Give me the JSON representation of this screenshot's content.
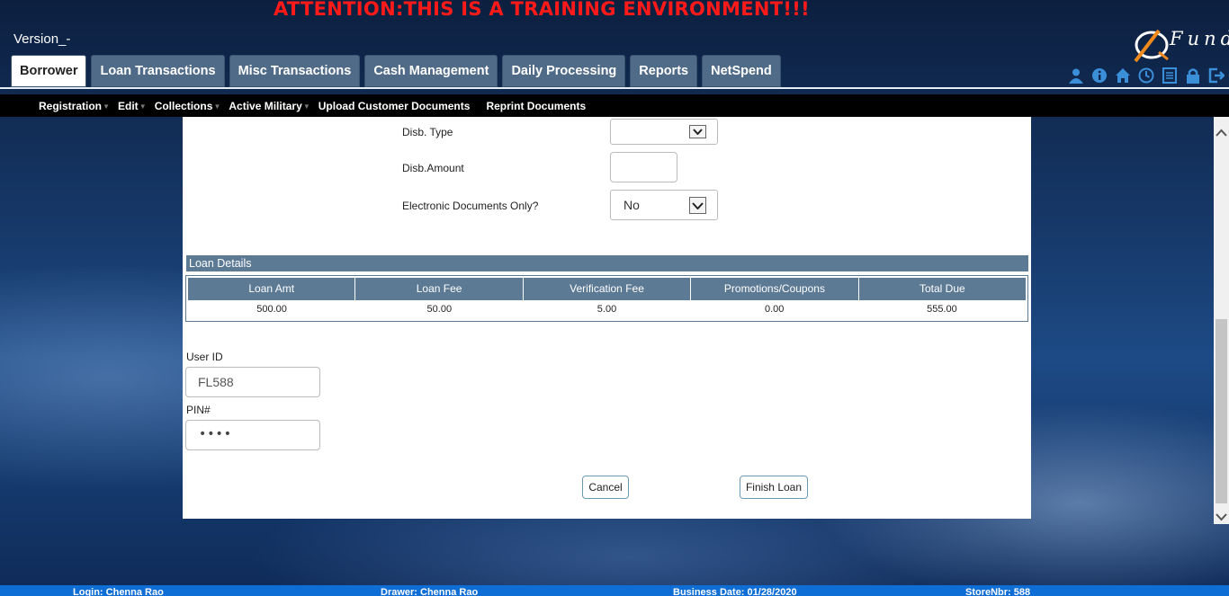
{
  "banner": {
    "attention": "ATTENTION:THIS IS A TRAINING ENVIRONMENT!!!"
  },
  "header": {
    "version": "Version_-",
    "logo_text": "Fund"
  },
  "tabs": [
    {
      "label": "Borrower",
      "active": true
    },
    {
      "label": "Loan Transactions"
    },
    {
      "label": "Misc Transactions"
    },
    {
      "label": "Cash Management"
    },
    {
      "label": "Daily Processing"
    },
    {
      "label": "Reports"
    },
    {
      "label": "NetSpend"
    }
  ],
  "toolbar_icons": [
    "user-icon",
    "info-icon",
    "home-icon",
    "clock-icon",
    "document-icon",
    "lock-icon",
    "logout-icon"
  ],
  "subnav": [
    {
      "label": "Registration",
      "caret": true
    },
    {
      "label": "Edit",
      "caret": true
    },
    {
      "label": "Collections",
      "caret": true
    },
    {
      "label": "Active Military",
      "caret": true
    },
    {
      "label": "Upload Customer Documents"
    },
    {
      "label": "Reprint Documents"
    }
  ],
  "form": {
    "disb_type_label": "Disb. Type",
    "disb_type_value": "",
    "disb_amount_label": "Disb.Amount",
    "disb_amount_value": "",
    "electronic_docs_label": "Electronic Documents Only?",
    "electronic_docs_value": "No"
  },
  "loan_details": {
    "title": "Loan Details",
    "columns": [
      "Loan Amt",
      "Loan Fee",
      "Verification Fee",
      "Promotions/Coupons",
      "Total Due"
    ],
    "values": [
      "500.00",
      "50.00",
      "5.00",
      "0.00",
      "555.00"
    ]
  },
  "auth": {
    "user_id_label": "User ID",
    "user_id_value": "FL588",
    "pin_label": "PIN#",
    "pin_value": "••••"
  },
  "buttons": {
    "cancel": "Cancel",
    "finish": "Finish Loan"
  },
  "footer": {
    "login": "Login: Chenna Rao",
    "drawer": "Drawer: Chenna Rao",
    "business_date": "Business Date: 01/28/2020",
    "store": "StoreNbr: 588"
  },
  "colors": {
    "accent": "#5d7a95",
    "attention": "#ff1a1a",
    "footer": "#0f6ed6",
    "logo_orange": "#f08a1c"
  }
}
